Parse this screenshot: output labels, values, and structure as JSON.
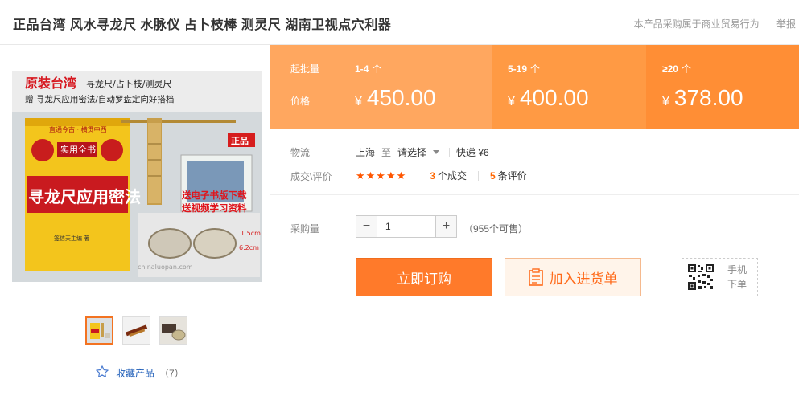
{
  "header": {
    "title": "正品台湾 风水寻龙尺 水脉仪 占卜枝棒 测灵尺 湖南卫视点穴利器",
    "notice": "本产品采购属于商业贸易行为",
    "report": "举报"
  },
  "gallery": {
    "product_image_text": {
      "line1": "原装台湾",
      "line1_sub": "寻龙尺/占卜枝/测灵尺",
      "line2": "赠  寻龙尺应用密法/自动罗盘定向好搭档",
      "book_title": "寻龙尺应用密法",
      "book_badge": "实用全书",
      "book_top": "直通今古 · 横贯中西",
      "book_author": "签信天主编 著",
      "zhengpin": "正品",
      "gift1": "送电子书版下载",
      "gift2": "送视频学习资料",
      "watermark": "chinaluopan.com",
      "dim1": "1.5cm",
      "dim2": "6.2cm"
    },
    "thumbnails": [
      "thumb-book",
      "thumb-rod",
      "thumb-compass"
    ],
    "favorite": {
      "label": "收藏产品",
      "count": "（7）"
    }
  },
  "pricing": {
    "qty_label": "起批量",
    "price_label": "价格",
    "currency": "¥",
    "tiers": [
      {
        "qty": "1-4",
        "unit": "个",
        "price": "450.00"
      },
      {
        "qty": "5-19",
        "unit": "个",
        "price": "400.00"
      },
      {
        "qty": "≥20",
        "unit": "个",
        "price": "378.00"
      }
    ]
  },
  "logistics": {
    "label": "物流",
    "from": "上海",
    "to_word": "至",
    "select_placeholder": "请选择",
    "shipping": "快递 ¥6"
  },
  "deals": {
    "label": "成交\\评价",
    "stars": "★★★★★",
    "deal_count": "3",
    "deal_suffix": "个成交",
    "review_count": "5",
    "review_suffix": "条评价"
  },
  "purchase": {
    "qty_label": "采购量",
    "qty_value": "1",
    "minus": "−",
    "plus": "+",
    "stock": "（955个可售）",
    "buy_label": "立即订购",
    "cart_label": "加入进货单",
    "mobile_line1": "手机",
    "mobile_line2": "下单"
  },
  "colors": {
    "accent": "#ff7a2a",
    "price_tier1": "#ffa75f",
    "price_tier2": "#ff9a44",
    "price_tier3": "#ff8e35",
    "link": "#1e5db8"
  }
}
